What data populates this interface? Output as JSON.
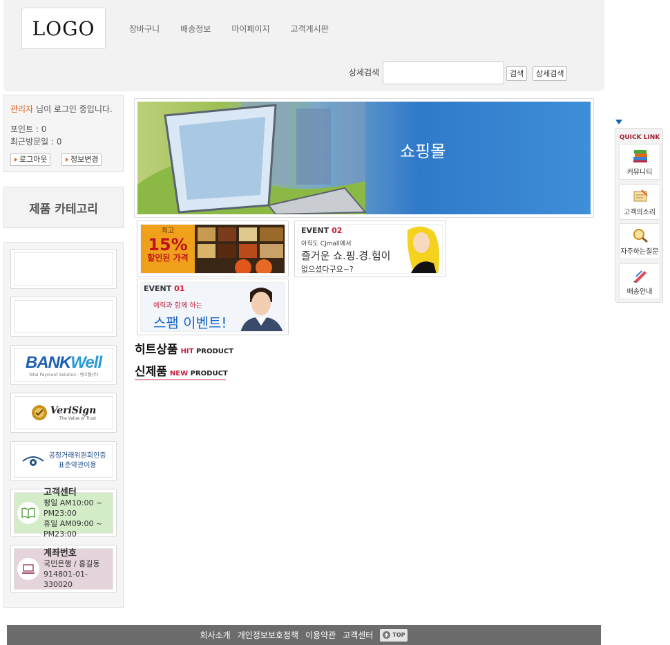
{
  "header": {
    "logo_text": "LOGO",
    "nav": [
      "장바구니",
      "배송정보",
      "마이페이지",
      "고객게시판"
    ],
    "search": {
      "label": "상세검색",
      "value": "",
      "search_button": "검색",
      "advanced_button": "상세검색"
    }
  },
  "login": {
    "user": "관리자",
    "status_suffix": " 님이 로그인 중입니다.",
    "points": "포인트 : 0",
    "last_visit": "최근방문일 : 0",
    "logout_button": "로그아웃",
    "edit_button": "정보변경"
  },
  "category": {
    "title": "제품 카테고리"
  },
  "left_banners": {
    "bankwell_a": "BANK",
    "bankwell_b": "Well",
    "bankwell_sub": "Total Payment Solution · 뱅크웰(주)",
    "verisign": "VeriSign",
    "verisign_sub": "The Value of Trust",
    "ftc_line1": "공정거래위원회인증",
    "ftc_line2": "표준약관이용",
    "cs": {
      "title": "고객센터",
      "weekday": "평일 AM10:00 ~ PM23:00",
      "holiday": "휴일 AM09:00 ~ PM23:00"
    },
    "account": {
      "title": "계좌번호",
      "bank": "국민은행 / 홍길동",
      "number": "914801-01-330020"
    }
  },
  "main": {
    "banner_title": "쇼핑몰",
    "events": {
      "sale_top": "최고",
      "sale_pct": "15%",
      "sale_bottom": "할인된 가격",
      "ev02_label": "EVENT",
      "ev02_num": "02",
      "ev02_line1": "아직도 CJmall에서",
      "ev02_line2": "즐거운 쇼.핑.경.험이",
      "ev02_line3": "없으셨다구요~?",
      "ev01_label": "EVENT",
      "ev01_num": "01",
      "ev01_line1": "예릭과 함께 하는",
      "ev01_line2": "스팸 이벤트!"
    },
    "hit": {
      "ko": "히트상품",
      "en_a": "HIT",
      "en_b": " PRODUCT"
    },
    "new": {
      "ko": "신제품",
      "en_a": "NEW",
      "en_b": " PRODUCT"
    }
  },
  "quick_link": {
    "title": "QUICK LINK",
    "items": [
      "커뮤니티",
      "고객의소리",
      "자주하는질문",
      "배송안내"
    ]
  },
  "footer": {
    "links": [
      "회사소개",
      "개인정보보호정책",
      "이용약관",
      "고객센터"
    ],
    "top_label": "TOP"
  },
  "colors": {
    "accent_orange": "#e0621c",
    "section_red": "#c01d3b",
    "footer_gray": "#6c6c6c",
    "banner_blue": "#2f79c9"
  }
}
